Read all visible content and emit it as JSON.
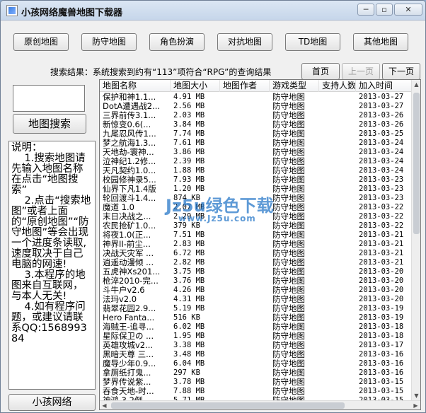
{
  "window": {
    "title": "小孩网络魔兽地图下载器",
    "controls": {
      "minimize": "─",
      "restore": "▫",
      "close": "✕"
    }
  },
  "toolbar": {
    "buttons": [
      "原创地图",
      "防守地图",
      "角色扮演",
      "对抗地图",
      "TD地图",
      "其他地图"
    ]
  },
  "status": {
    "text": "搜索结果：系统搜索到约有“113”项符合“RPG”的查询结果"
  },
  "pager": {
    "first": "首页",
    "prev": "上一页",
    "next": "下一页"
  },
  "search": {
    "value": "",
    "button": "地图搜索"
  },
  "help": {
    "text": "说明：\n    1.搜索地图请先输入地图名称在点击“地图搜索”\n    2.点击“搜索地图”或者上面的“原创地图”“防守地图”等会出现一个进度条读取,速度取决于自己电脑的网速!\n    3.本程序的地图来自互联网，与本人无关!\n    4.如有程序问题，或建议请联系QQ:156899384"
  },
  "brand_button": "小孩网络",
  "watermark": {
    "text": "Jz5u绿色下载",
    "url": "www.Jz5u.com"
  },
  "table": {
    "columns": [
      "地图名称",
      "地图大小",
      "地图作者",
      "游戏类型",
      "支持人数",
      "加入时间"
    ],
    "rows": [
      [
        "保护和神1.1...",
        "4.91 MB",
        "",
        "防守地图",
        "",
        "2013-03-27"
      ],
      [
        "DotA遭遇战2...",
        "2.56 MB",
        "",
        "防守地图",
        "",
        "2013-03-27"
      ],
      [
        "三界前传3.1...",
        "2.03 MB",
        "",
        "防守地图",
        "",
        "2013-03-26"
      ],
      [
        "新惊变0.6(...",
        "3.84 MB",
        "",
        "防守地图",
        "",
        "2013-03-26"
      ],
      [
        "九尾忍风传1...",
        "7.74 MB",
        "",
        "防守地图",
        "",
        "2013-03-25"
      ],
      [
        "梦之航海1.3...",
        "7.61 MB",
        "",
        "防守地图",
        "",
        "2013-03-24"
      ],
      [
        "天地劫-寰神...",
        "3.86 MB",
        "",
        "防守地图",
        "",
        "2013-03-24"
      ],
      [
        "泣神纪1.2修...",
        "2.39 MB",
        "",
        "防守地图",
        "",
        "2013-03-24"
      ],
      [
        "天凡契约1.0...",
        "1.88 MB",
        "",
        "防守地图",
        "",
        "2013-03-24"
      ],
      [
        "校园修神录5...",
        "7.93 MB",
        "",
        "防守地图",
        "",
        "2013-03-23"
      ],
      [
        "仙界下凡1.4版",
        "1.20 MB",
        "",
        "防守地图",
        "",
        "2013-03-23"
      ],
      [
        "轮回渡斗1.4...",
        "874 KB",
        "",
        "防守地图",
        "",
        "2013-03-23"
      ],
      [
        "魔道 1.0",
        "2.07 MB",
        "",
        "防守地图",
        "",
        "2013-03-22"
      ],
      [
        "末日决战之...",
        "2.29 MB",
        "",
        "防守地图",
        "",
        "2013-03-22"
      ],
      [
        "农民抢矿1.0...",
        "379 KB",
        "",
        "防守地图",
        "",
        "2013-03-22"
      ],
      [
        "将夜1.0(正...",
        "7.51 MB",
        "",
        "防守地图",
        "",
        "2013-03-21"
      ],
      [
        "神界II-前尘...",
        "2.83 MB",
        "",
        "防守地图",
        "",
        "2013-03-21"
      ],
      [
        "决战天灾军 ...",
        "6.72 MB",
        "",
        "防守地图",
        "",
        "2013-03-21"
      ],
      [
        "逍遥动漫倾 ...",
        "2.82 MB",
        "",
        "防守地图",
        "",
        "2013-03-21"
      ],
      [
        "五虎神Xs201...",
        "3.75 MB",
        "",
        "防守地图",
        "",
        "2013-03-20"
      ],
      [
        "枪淬2010-完...",
        "3.76 MB",
        "",
        "防守地图",
        "",
        "2013-03-20"
      ],
      [
        "斗牛户v2.6",
        "4.26 MB",
        "",
        "防守地图",
        "",
        "2013-03-20"
      ],
      [
        "法玛v2.0",
        "4.31 MB",
        "",
        "防守地图",
        "",
        "2013-03-20"
      ],
      [
        "翡翠花园2.9...",
        "5.19 MB",
        "",
        "防守地图",
        "",
        "2013-03-19"
      ],
      [
        " Hero Fanta...",
        "516 KB",
        "",
        "防守地图",
        "",
        "2013-03-19"
      ],
      [
        "海贼王-追寻...",
        "6.02 MB",
        "",
        "防守地图",
        "",
        "2013-03-18"
      ],
      [
        "星际保卫の ...",
        "1.95 MB",
        "",
        "防守地图",
        "",
        "2013-03-18"
      ],
      [
        "英雄攻城v2...",
        "3.38 MB",
        "",
        "防守地图",
        "",
        "2013-03-17"
      ],
      [
        "黑暗天尊 三...",
        "3.48 MB",
        "",
        "防守地图",
        "",
        "2013-03-16"
      ],
      [
        "魔导少年0.9...",
        "6.04 MB",
        "",
        "防守地图",
        "",
        "2013-03-16"
      ],
      [
        "拿厕纸打鬼...",
        "297 KB",
        "",
        "防守地图",
        "",
        "2013-03-16"
      ],
      [
        "梦界传说紫...",
        "3.78 MB",
        "",
        "防守地图",
        "",
        "2013-03-15"
      ],
      [
        "吞食天地-时...",
        "7.88 MB",
        "",
        "防守地图",
        "",
        "2013-03-15"
      ],
      [
        "神鸿 3.2倒...",
        "5.71 MB",
        "",
        "防守地图",
        "",
        "2013-03-15"
      ]
    ]
  }
}
